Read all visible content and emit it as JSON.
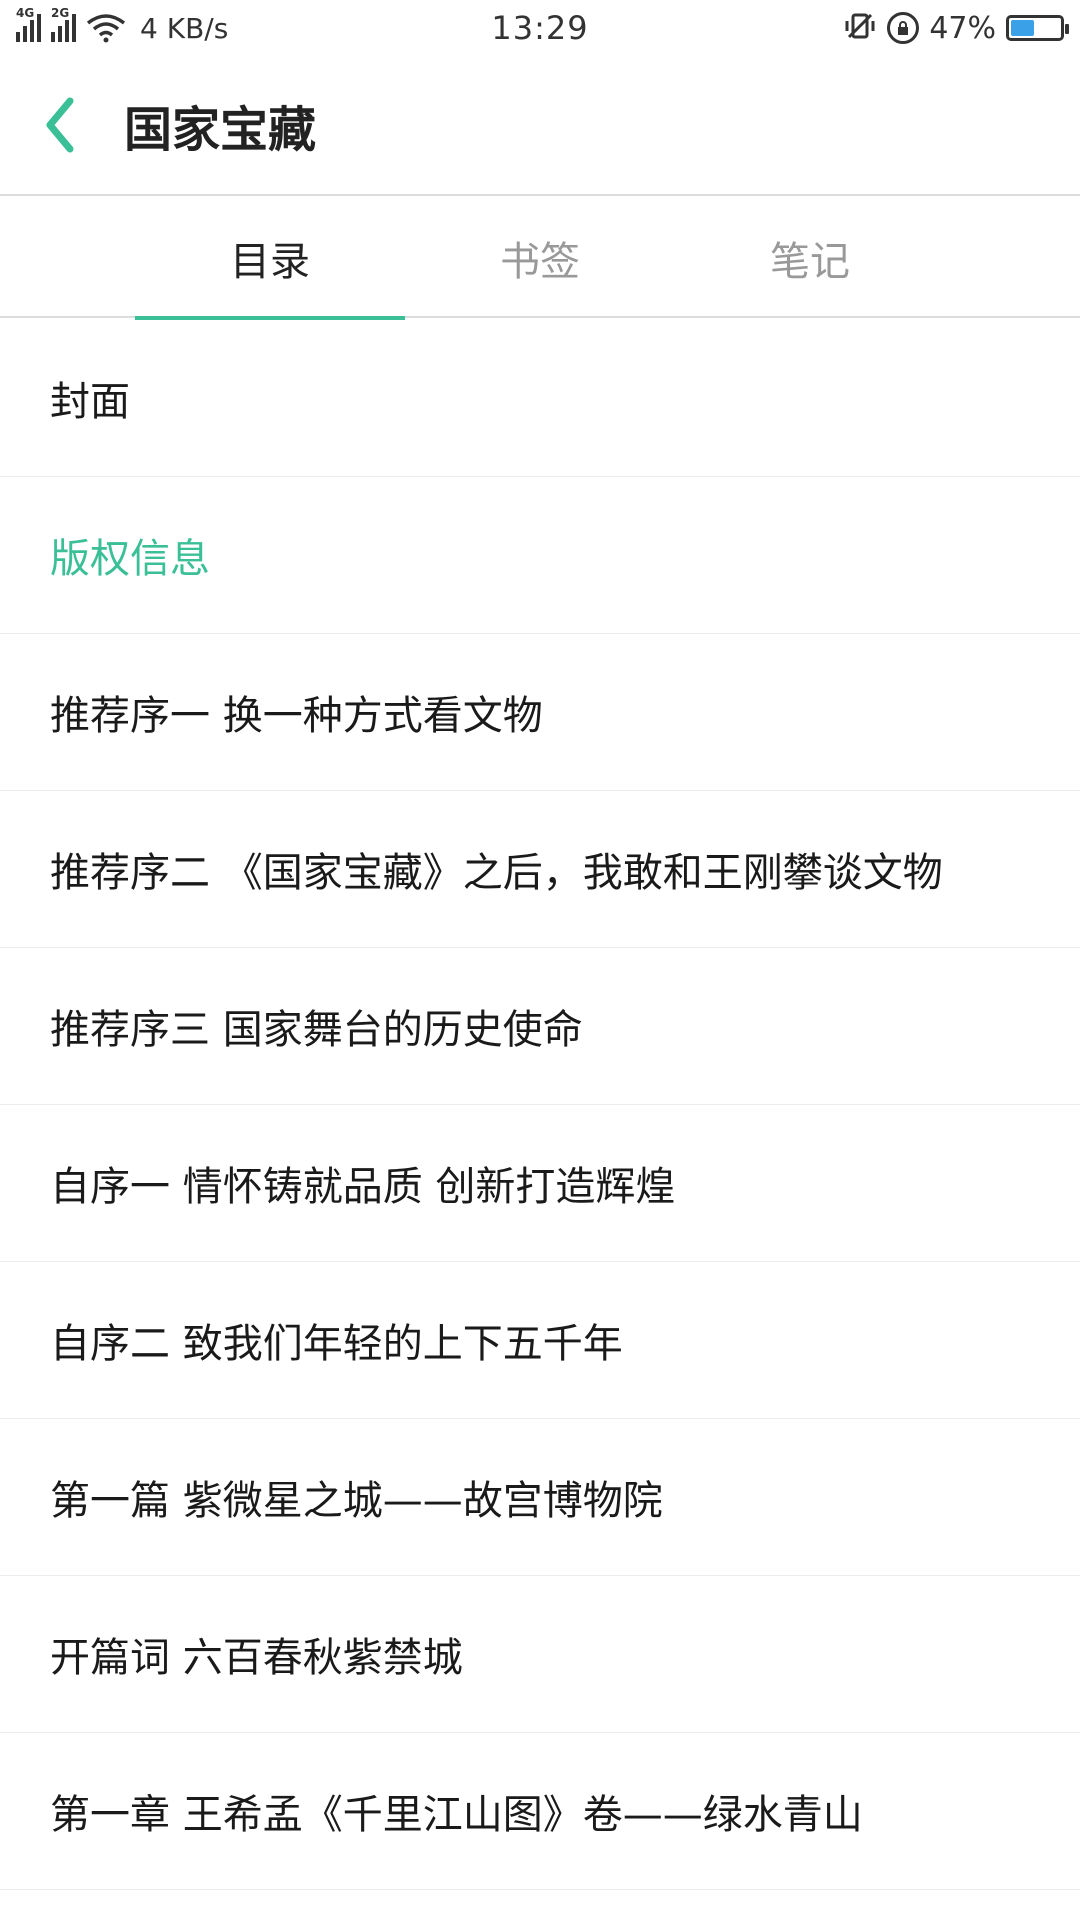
{
  "status_bar": {
    "network1": "4G",
    "network2": "2G",
    "speed": "4 KB/s",
    "time": "13:29",
    "battery_percent": "47%",
    "battery_level": 0.47
  },
  "header": {
    "title": "国家宝藏"
  },
  "tabs": [
    {
      "label": "目录",
      "active": true
    },
    {
      "label": "书签",
      "active": false
    },
    {
      "label": "笔记",
      "active": false
    }
  ],
  "toc": [
    {
      "label": "封面"
    },
    {
      "label": "版权信息",
      "current": true
    },
    {
      "label": "推荐序一 换一种方式看文物"
    },
    {
      "label": "推荐序二 《国家宝藏》之后，我敢和王刚攀谈文物"
    },
    {
      "label": "推荐序三 国家舞台的历史使命"
    },
    {
      "label": "自序一 情怀铸就品质 创新打造辉煌"
    },
    {
      "label": "自序二 致我们年轻的上下五千年"
    },
    {
      "label": "第一篇 紫微星之城——故宫博物院"
    },
    {
      "label": "开篇词 六百春秋紫禁城"
    },
    {
      "label": "第一章 王希孟《千里江山图》卷——绿水青山"
    }
  ],
  "colors": {
    "accent": "#3bbf97"
  }
}
